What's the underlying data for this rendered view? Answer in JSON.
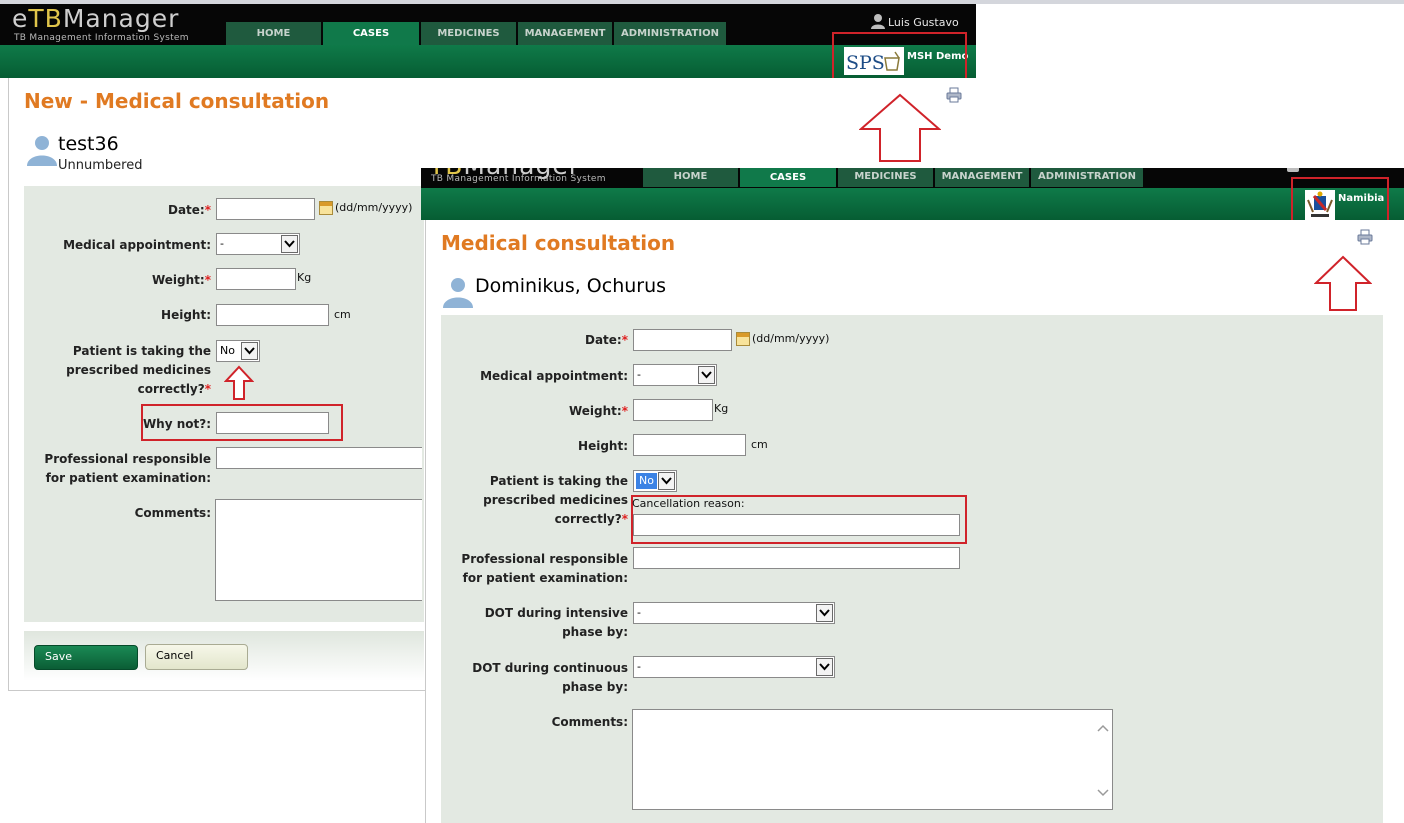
{
  "window_a": {
    "logo_main_e": "e",
    "logo_main_tb": "TB",
    "logo_main_rest": "Manager",
    "logo_sub": "TB Management Information System",
    "nav": [
      "HOME",
      "CASES",
      "MEDICINES",
      "MANAGEMENT",
      "ADMINISTRATION"
    ],
    "active_tab": "CASES",
    "user": "Luis Gustavo",
    "org_logo_text": "SPS",
    "org_name": "MSH Demo",
    "page_title": "New - Medical consultation",
    "patient_name": "test36",
    "patient_number": "Unnumbered",
    "form": {
      "date_label": "Date:",
      "date_format": "(dd/mm/yyyy)",
      "appointment_label": "Medical appointment:",
      "appointment_value": "-",
      "weight_label": "Weight:",
      "weight_unit": "Kg",
      "height_label": "Height:",
      "height_unit": "cm",
      "taking_label_1": "Patient is taking the",
      "taking_label_2": "prescribed medicines",
      "taking_label_3": "correctly?",
      "taking_value": "No",
      "why_not_label": "Why not?:",
      "professional_label_1": "Professional responsible",
      "professional_label_2": "for patient examination:",
      "comments_label": "Comments:",
      "required_mark": "*"
    },
    "save_label": "Save",
    "cancel_label": "Cancel"
  },
  "window_b": {
    "logo_sub": "TB Management Information System",
    "nav": [
      "HOME",
      "CASES",
      "MEDICINES",
      "MANAGEMENT",
      "ADMINISTRATION"
    ],
    "active_tab": "CASES",
    "org_name": "Namibia",
    "page_title": "Medical consultation",
    "patient_name": "Dominikus, Ochurus",
    "form": {
      "date_label": "Date:",
      "date_format": "(dd/mm/yyyy)",
      "appointment_label": "Medical appointment:",
      "appointment_value": "-",
      "weight_label": "Weight:",
      "weight_unit": "Kg",
      "height_label": "Height:",
      "height_unit": "cm",
      "taking_label_1": "Patient is taking the",
      "taking_label_2": "prescribed medicines",
      "taking_label_3": "correctly?",
      "taking_value": "No",
      "cancellation_label": "Cancellation reason:",
      "professional_label_1": "Professional responsible",
      "professional_label_2": "for patient examination:",
      "dot_intensive_label_1": "DOT during intensive",
      "dot_intensive_label_2": "phase by:",
      "dot_intensive_value": "-",
      "dot_continuous_label_1": "DOT during continuous",
      "dot_continuous_label_2": "phase by:",
      "dot_continuous_value": "-",
      "comments_label": "Comments:",
      "required_mark": "*"
    }
  },
  "colors": {
    "brand_green": "#0b6b3f",
    "title_orange": "#e07a22",
    "highlight_red": "#d0232a",
    "form_bg": "#e3e9e2"
  }
}
